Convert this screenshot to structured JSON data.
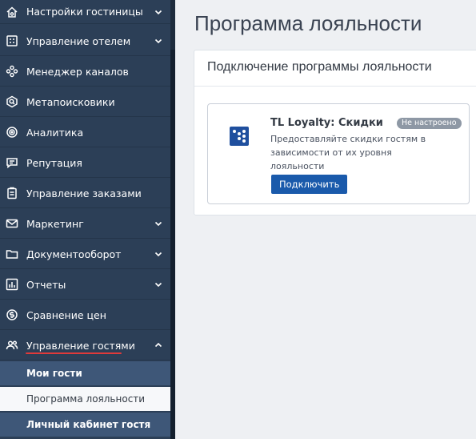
{
  "sidebar": {
    "items": [
      {
        "label": "Настройки гостиницы",
        "icon": "home-gear-icon",
        "has_chevron": true,
        "expanded": false
      },
      {
        "label": "Управление отелем",
        "icon": "hotel-grid-icon",
        "has_chevron": true,
        "expanded": false
      },
      {
        "label": "Менеджер каналов",
        "icon": "channels-hexagon-icon",
        "has_chevron": false
      },
      {
        "label": "Метапоисковики",
        "icon": "metasearch-icon",
        "has_chevron": false
      },
      {
        "label": "Аналитика",
        "icon": "analytics-target-icon",
        "has_chevron": false
      },
      {
        "label": "Репутация",
        "icon": "reputation-chat-icon",
        "has_chevron": false
      },
      {
        "label": "Управление заказами",
        "icon": "orders-clipboard-icon",
        "has_chevron": false
      },
      {
        "label": "Маркетинг",
        "icon": "mail-icon",
        "has_chevron": true,
        "expanded": false
      },
      {
        "label": "Документооборот",
        "icon": "folder-icon",
        "has_chevron": true,
        "expanded": false
      },
      {
        "label": "Отчеты",
        "icon": "bar-chart-icon",
        "has_chevron": true,
        "expanded": false
      },
      {
        "label": "Сравнение цен",
        "icon": "price-compare-icon",
        "has_chevron": false
      },
      {
        "label": "Управление гостями",
        "icon": "guests-icon",
        "has_chevron": true,
        "expanded": true
      }
    ],
    "guest_subitems": [
      {
        "label": "Мои гости",
        "active": false
      },
      {
        "label": "Программа лояльности",
        "active": true
      },
      {
        "label": "Личный кабинет гостя",
        "active": false
      }
    ]
  },
  "main": {
    "page_title": "Программа лояльности",
    "panel_title": "Подключение программы лояльности",
    "card": {
      "title": "TL Loyalty: Скидки",
      "status_badge": "Не настроено",
      "description": "Предоставляйте скидки гостям в зависимости от их уровня лояльности",
      "button_label": "Подключить",
      "logo_icon": "dice-logo-icon"
    }
  },
  "colors": {
    "sidebar_bg": "#2c3f57",
    "submenu_bg": "#3e5778",
    "active_bg": "#f7f8fa",
    "highlight_underline": "#e03a3a",
    "button_primary": "#1a5aab",
    "badge_bg": "#8e98a5",
    "page_bg": "#eef0f3"
  }
}
